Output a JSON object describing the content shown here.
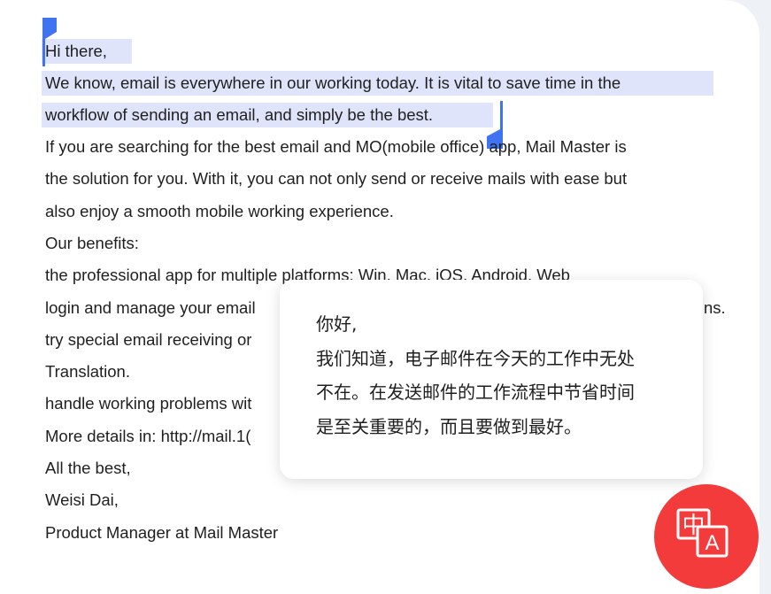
{
  "email": {
    "lines": [
      "Hi there,",
      " We know, email is everywhere in our working today. It is vital to save time in the",
      "workflow of sending an email, and simply be the best.",
      "If you are searching for the best email and MO(mobile office) app, Mail Master is",
      "the solution for you. With it, you can not only  send or receive mails with ease but",
      "also enjoy a smooth mobile working experience.",
      "Our benefits:",
      "the professional app for multiple platforms: Win, Mac, iOS, Android, Web",
      "login and manage your email",
      "try special email receiving or",
      "Translation.",
      "handle working problems wit",
      "More details in: http://mail.1(",
      "All the best,",
      "Weisi Dai,",
      "Product Manager at Mail Master"
    ],
    "line_cut_suffix": "ns."
  },
  "translation_popup": {
    "lines": [
      "你好,",
      "我们知道，电子邮件在今天的工作中无处",
      "不在。在发送邮件的工作流程中节省时间",
      "是至关重要的，而且要做到最好。"
    ]
  },
  "translate_button": {
    "icon": "translate-icon",
    "glyph_source": "中",
    "glyph_target": "A",
    "color": "#f33b3b"
  },
  "selection": {
    "color": "#dfe4fb",
    "handle_color": "#3f73f0"
  }
}
